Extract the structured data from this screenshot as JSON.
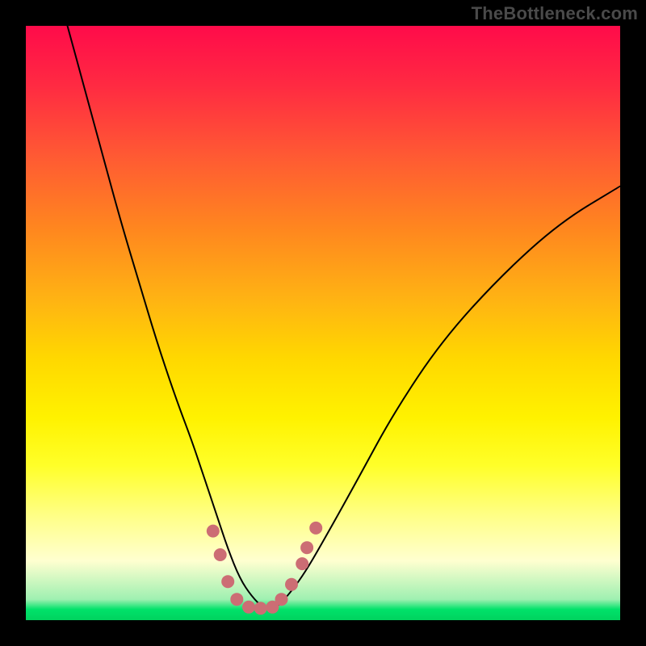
{
  "watermark": "TheBottleneck.com",
  "chart_data": {
    "type": "line",
    "title": "",
    "xlabel": "",
    "ylabel": "",
    "xlim": [
      0,
      100
    ],
    "ylim": [
      0,
      100
    ],
    "grid": false,
    "legend": false,
    "series": [
      {
        "name": "bottleneck-curve",
        "color": "#000000",
        "x": [
          7,
          10,
          13,
          16,
          19,
          22,
          25,
          28,
          30,
          32,
          34,
          36,
          38,
          40,
          42,
          44,
          47,
          51,
          56,
          62,
          70,
          80,
          90,
          100
        ],
        "y": [
          100,
          89,
          78,
          67,
          57,
          47,
          38,
          30,
          24,
          18,
          12,
          7,
          4,
          2,
          2,
          4,
          8,
          15,
          24,
          35,
          47,
          58,
          67,
          73
        ]
      }
    ],
    "markers": {
      "name": "valley-markers",
      "color": "#cc6d74",
      "radius_px": 8,
      "points": [
        {
          "x": 31.5,
          "y": 15
        },
        {
          "x": 32.7,
          "y": 11
        },
        {
          "x": 34.0,
          "y": 6.5
        },
        {
          "x": 35.5,
          "y": 3.5
        },
        {
          "x": 37.5,
          "y": 2.2
        },
        {
          "x": 39.5,
          "y": 2.0
        },
        {
          "x": 41.5,
          "y": 2.2
        },
        {
          "x": 43.0,
          "y": 3.5
        },
        {
          "x": 44.7,
          "y": 6.0
        },
        {
          "x": 46.5,
          "y": 9.5
        },
        {
          "x": 47.3,
          "y": 12.2
        },
        {
          "x": 48.8,
          "y": 15.5
        }
      ]
    },
    "background_gradient": {
      "top": "#ff0b4a",
      "mid": "#fff200",
      "bottom": "#00d25e"
    }
  }
}
